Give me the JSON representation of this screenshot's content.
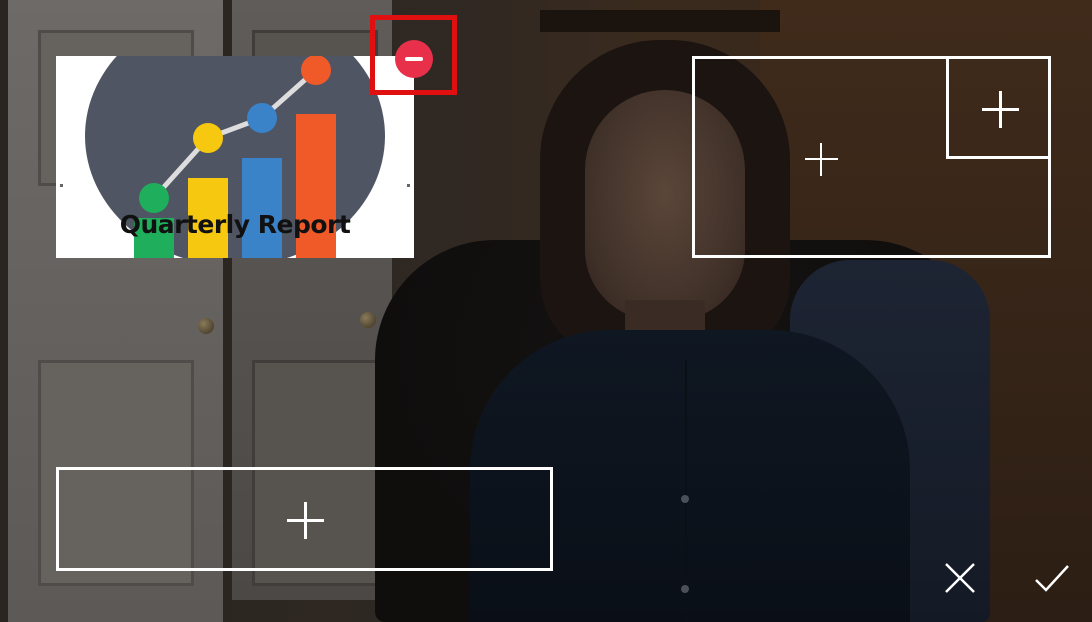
{
  "thumbnail": {
    "title": "Quarterly Report",
    "chart_data": {
      "type": "bar",
      "values": [
        1,
        2,
        2.5,
        3.6
      ],
      "line_points": [
        1.5,
        3,
        3.5,
        4.7
      ]
    }
  },
  "slots": [
    {
      "id": "slot-top-right",
      "action": "add"
    },
    {
      "id": "slot-top-right-inner",
      "action": "add"
    },
    {
      "id": "slot-bottom-left",
      "action": "add"
    }
  ],
  "actions": {
    "remove": "remove-icon",
    "cancel": "close-icon",
    "confirm": "check-icon"
  },
  "colors": {
    "remove": "#e8304a",
    "highlight": "#e01010",
    "bar_green": "#1fae5b",
    "bar_yellow": "#f6c80f",
    "bar_blue": "#3b83c8",
    "bar_orange": "#f05a28",
    "circle_bg": "#4f5563"
  }
}
